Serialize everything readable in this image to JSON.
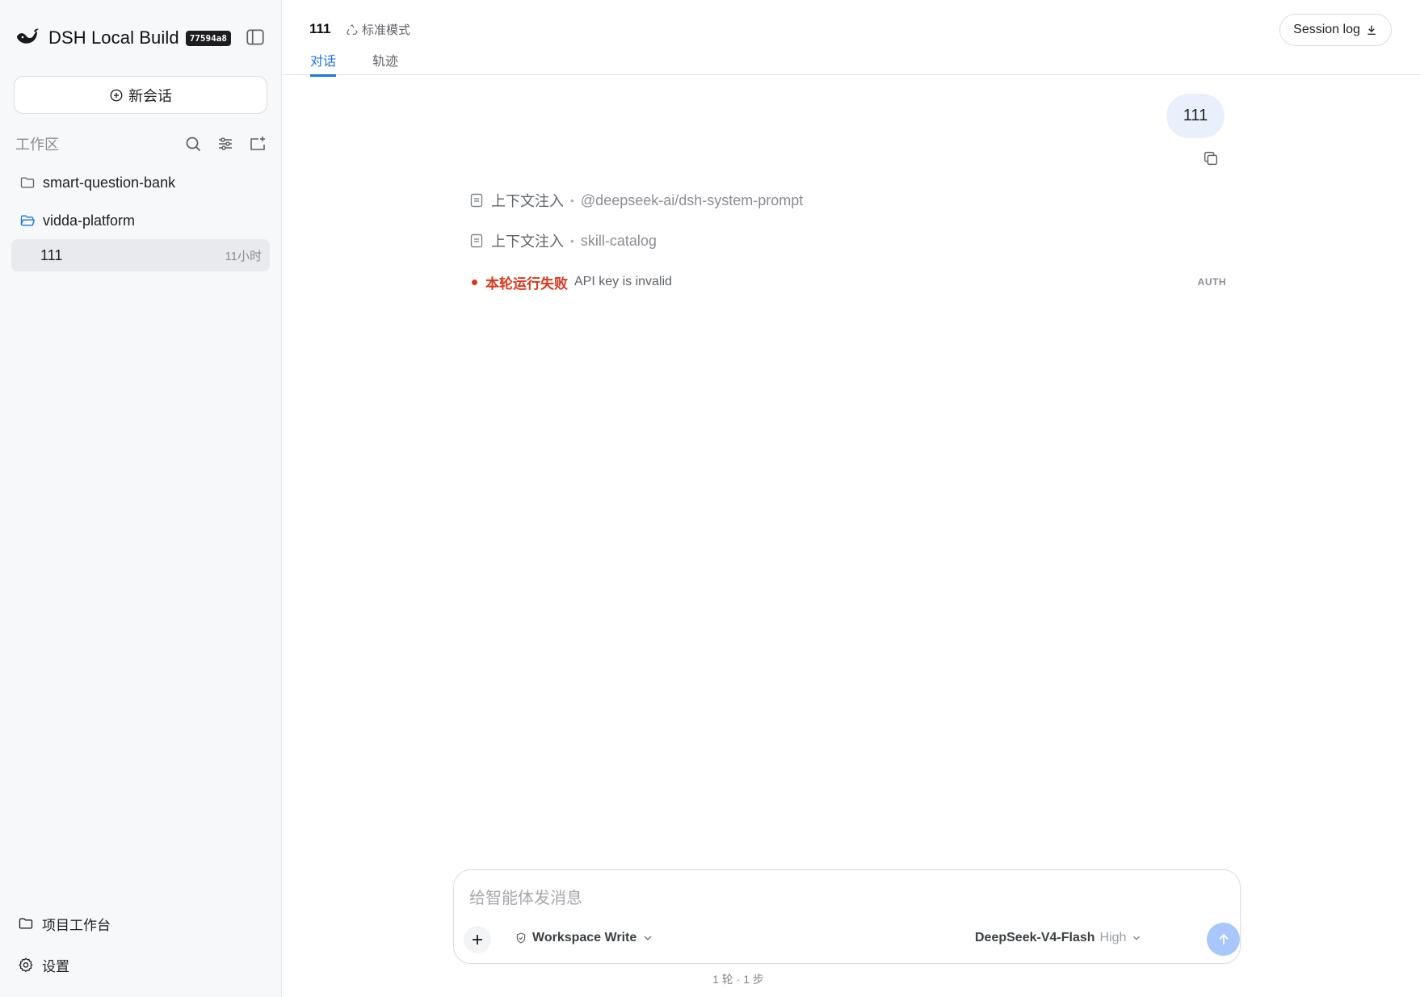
{
  "sidebar": {
    "brand": {
      "name": "DSH Local Build",
      "badge": "77594a8"
    },
    "new_chat_label": "新会话",
    "workspace_title": "工作区",
    "folders": [
      {
        "name": "smart-question-bank",
        "open": false
      },
      {
        "name": "vidda-platform",
        "open": true
      }
    ],
    "session": {
      "title": "111",
      "time": "11小时"
    },
    "bottom": {
      "projects_label": "项目工作台",
      "settings_label": "设置"
    }
  },
  "header": {
    "title": "111",
    "mode": "标准模式",
    "tabs": [
      {
        "label": "对话",
        "active": true
      },
      {
        "label": "轨迹",
        "active": false
      }
    ],
    "session_log_label": "Session log"
  },
  "conversation": {
    "user_message": "111",
    "context_rows": [
      {
        "label": "上下文注入",
        "value": "@deepseek-ai/dsh-system-prompt"
      },
      {
        "label": "上下文注入",
        "value": "skill-catalog"
      }
    ],
    "error": {
      "title": "本轮运行失败",
      "message": "API key is invalid",
      "code": "AUTH"
    }
  },
  "composer": {
    "placeholder": "给智能体发消息",
    "permission": "Workspace Write",
    "model": "DeepSeek-V4-Flash",
    "effort": "High",
    "stats": "1 轮 · 1 步"
  },
  "colors": {
    "accent": "#1a73e8",
    "error": "#d9381e",
    "send_button": "#a8c7fa",
    "user_bubble": "#eaf0fb"
  }
}
